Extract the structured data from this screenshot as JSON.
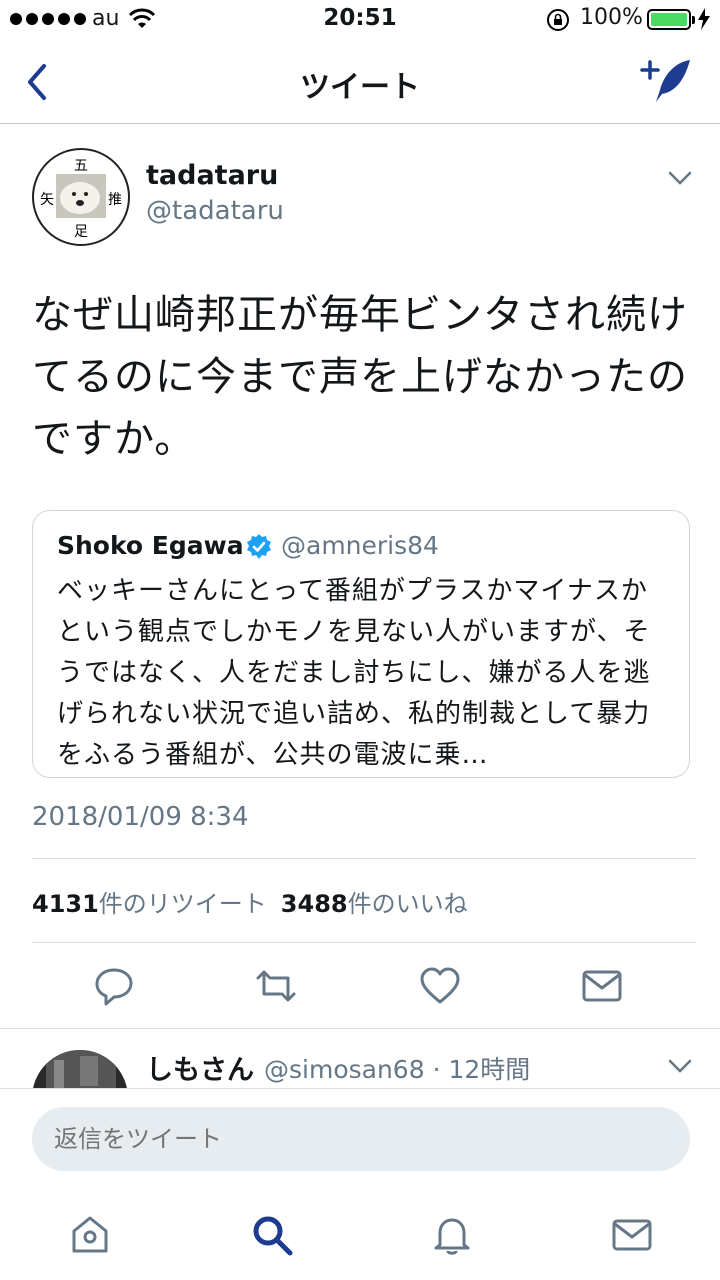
{
  "status_bar": {
    "carrier": "au",
    "time": "20:51",
    "battery": "100%"
  },
  "nav": {
    "title": "ツイート"
  },
  "tweet": {
    "author_name": "tadataru",
    "author_handle": "@tadataru",
    "text": "なぜ山崎邦正が毎年ビンタされ続けてるのに今まで声を上げなかったのですか。",
    "quote": {
      "name": "Shoko Egawa",
      "handle": "@amneris84",
      "text": "ベッキーさんにとって番組がプラスかマイナスかという観点でしかモノを見ない人がいますが、そうではなく、人をだまし討ちにし、嫌がる人を逃げられない状況で追い詰め、私的制裁として暴力をふるう番組が、公共の電波に乗…"
    },
    "timestamp": "2018/01/09 8:34",
    "retweet_count": "4131",
    "retweet_label": "件のリツイート",
    "like_count": "3488",
    "like_label": "件のいいね"
  },
  "reply_preview": {
    "name": "しもさん",
    "meta": "@simosan68 · 12時間"
  },
  "composer": {
    "placeholder": "返信をツイート"
  },
  "colors": {
    "accent": "#1d3c8f",
    "muted": "#657786",
    "battery_green": "#4cd964"
  }
}
